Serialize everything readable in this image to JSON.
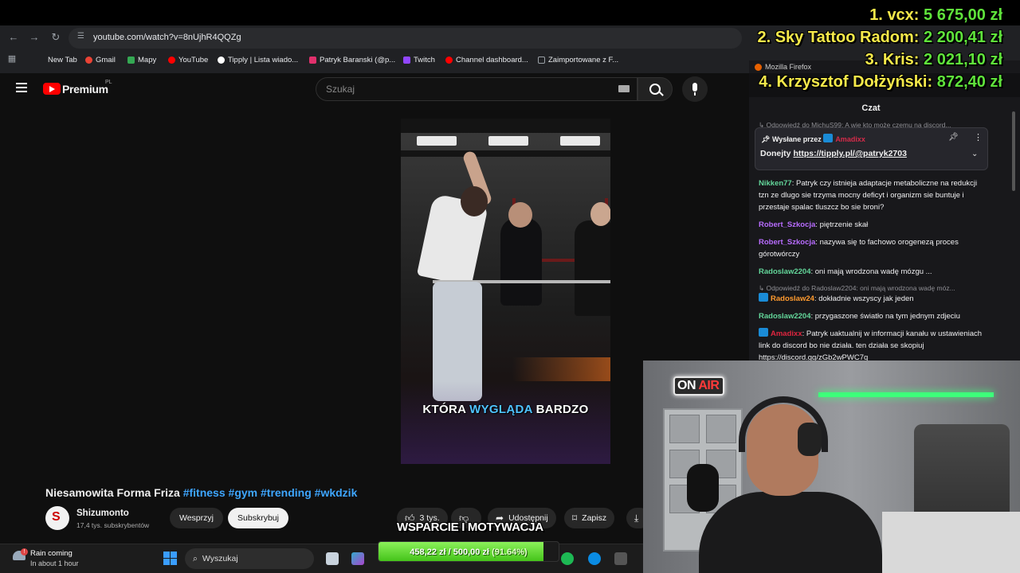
{
  "browser": {
    "url": "youtube.com/watch?v=8nUjhR4QQZg",
    "bookmarks": [
      {
        "label": "New Tab",
        "color": "#5f6368"
      },
      {
        "label": "Gmail",
        "color": "#ea4335"
      },
      {
        "label": "Mapy",
        "color": "#34a853"
      },
      {
        "label": "YouTube",
        "color": "#ff0000"
      },
      {
        "label": "Tipply | Lista wiado...",
        "color": "#ffffff"
      },
      {
        "label": "Patryk Baranski (@p...",
        "color": "#e1306c"
      },
      {
        "label": "Twitch",
        "color": "#9146ff"
      },
      {
        "label": "Channel dashboard...",
        "color": "#ff0000"
      },
      {
        "label": "Zaimportowane z F...",
        "color": "#9aa0a6"
      }
    ]
  },
  "youtube": {
    "brand": "Premium",
    "region": "PL",
    "search_placeholder": "Szukaj",
    "video": {
      "caption_1": "KTÓRA",
      "caption_hl": "WYGLĄDA",
      "caption_2": "BARDZO",
      "title": "Niesamowita Forma Friza",
      "tags": [
        "#fitness",
        "#gym",
        "#trending",
        "#wkdzik"
      ]
    },
    "channel": {
      "name": "Shizumonto",
      "subs": "17,4 tys. subskrybentów",
      "support_label": "Wesprzyj",
      "subscribe_label": "Subskrybuj"
    },
    "actions": {
      "likes": "3 tys.",
      "share": "Udostępnij",
      "save": "Zapisz"
    }
  },
  "chat": {
    "window_title": "Mozilla Firefox",
    "title": "Czat",
    "reply_top": "Odpowiedź do MichuS99: A wie kto może czemu na discord...",
    "pinned": {
      "by_label": "Wysłane przez",
      "by_user": "Amadixx",
      "text": "Donejty",
      "link": "https://tipply.pl/@patryk2703"
    },
    "messages": [
      {
        "user": "Nikken77",
        "cls": "u-green",
        "badge": false,
        "text": "Patryk czy istnieja adaptacje metaboliczne na redukcji tzn ze dlugo sie trzyma mocny deficyt i organizm sie buntuje i przestaje spalac tluszcz bo sie broni?"
      },
      {
        "user": "Robert_Szkocja",
        "cls": "u-purple",
        "badge": false,
        "text": "piętrzenie skał"
      },
      {
        "user": "Robert_Szkocja",
        "cls": "u-purple",
        "badge": false,
        "text": "nazywa się to fachowo orogenezą proces górotwórczy"
      },
      {
        "user": "Radoslaw2204",
        "cls": "u-green",
        "badge": false,
        "text": "oni mają wrodzona wadę mózgu ..."
      },
      {
        "reply": "Odpowiedź do Radoslaw2204: oni mają wrodzona wadę móz..."
      },
      {
        "user": "Radoslaw24",
        "cls": "u-orange",
        "badge": true,
        "text": "dokładnie wszyscy jak jeden"
      },
      {
        "user": "Radoslaw2204",
        "cls": "u-green",
        "badge": false,
        "text": "przygaszone światło na tym jednym zdjeciu"
      },
      {
        "user": "Amadixx",
        "cls": "u-red",
        "badge": true,
        "text": "Patryk uaktualnij w informacji kanału w ustawieniach link do discord bo nie działa. ten działa se skopiuj https://discord.gg/zGb2wPWC7q"
      }
    ]
  },
  "donors": [
    {
      "rank": "1.",
      "name": "vcx:",
      "amount": "5 675,00 zł"
    },
    {
      "rank": "2.",
      "name": "Sky Tattoo Radom:",
      "amount": "2 200,41 zł"
    },
    {
      "rank": "3.",
      "name": "Kris:",
      "amount": "2 021,10 zł"
    },
    {
      "rank": "4.",
      "name": "Krzysztof Dołżyński:",
      "amount": "872,40 zł"
    }
  ],
  "webcam": {
    "on": "ON",
    "air": "AIR"
  },
  "goal": {
    "label": "WSPARCIE I MOTYWACJA",
    "current": "458,22 zł",
    "target": "500,00 zł",
    "percent_text": "(91.64%)",
    "percent": 91.64
  },
  "taskbar": {
    "weather_title": "Rain coming",
    "weather_sub": "In about 1 hour",
    "search_placeholder": "Wyszukaj"
  }
}
